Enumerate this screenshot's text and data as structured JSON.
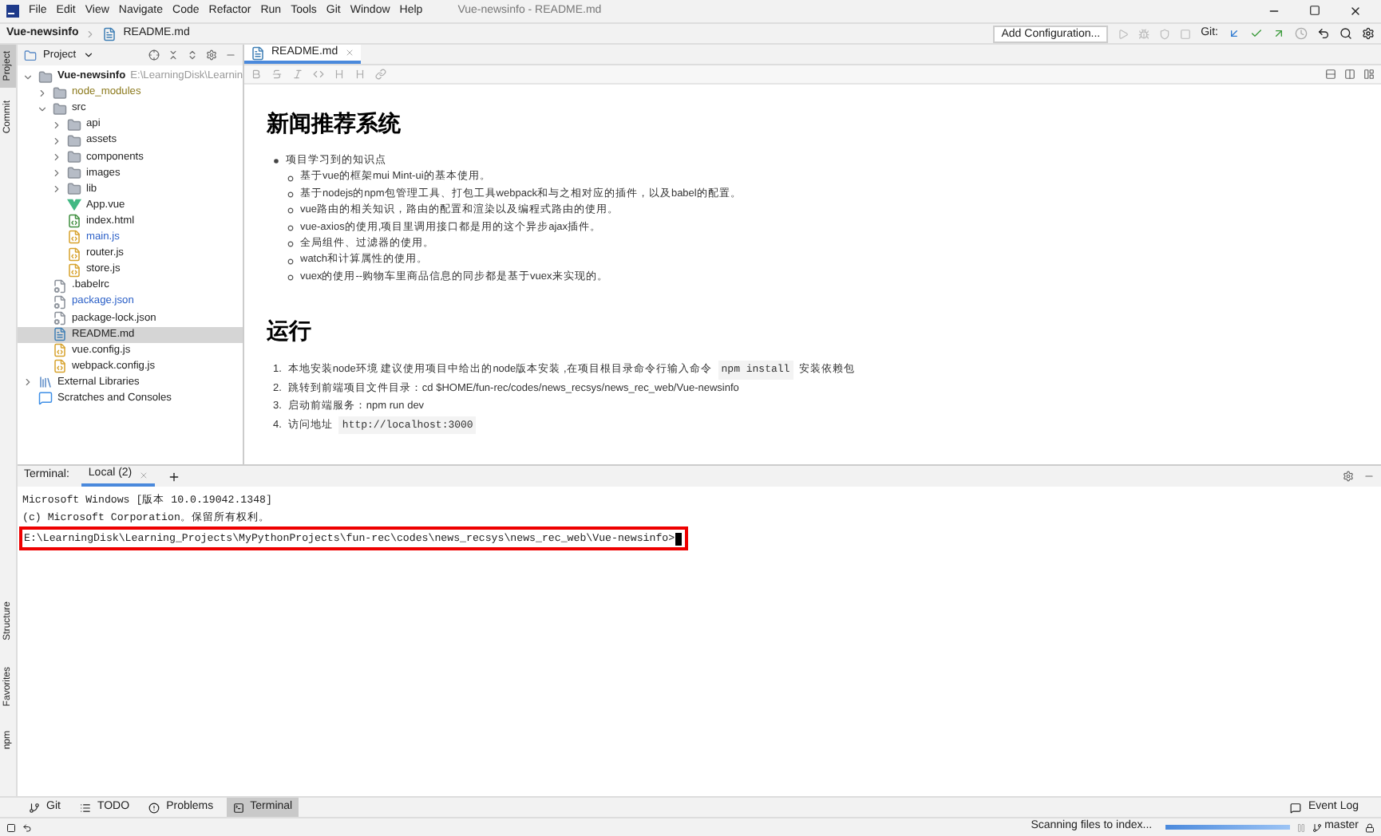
{
  "menu": [
    "File",
    "Edit",
    "View",
    "Navigate",
    "Code",
    "Refactor",
    "Run",
    "Tools",
    "Git",
    "Window",
    "Help"
  ],
  "window": {
    "title": "Vue-newsinfo - README.md"
  },
  "breadcrumb": [
    "Vue-newsinfo",
    "README.md"
  ],
  "toolbar": {
    "run_config": "Add Configuration...",
    "git_label": "Git:"
  },
  "left_strip_top": [
    {
      "label": "Project",
      "selected": true
    },
    {
      "label": "Commit",
      "selected": false
    }
  ],
  "left_strip_bottom": [
    {
      "label": "Structure",
      "selected": false
    },
    {
      "label": "Favorites",
      "selected": false
    },
    {
      "label": "npm",
      "selected": false
    }
  ],
  "project_panel": {
    "title": "Project",
    "tree": [
      {
        "label": "Vue-newsinfo",
        "path": "E:\\LearningDisk\\Learnin",
        "kind": "folder",
        "color": "#222222",
        "expanded": true,
        "selected": false,
        "children": [
          {
            "label": "node_modules",
            "kind": "folder",
            "color": "#8c7a1d",
            "expanded": false,
            "selected": false
          },
          {
            "label": "src",
            "kind": "folder",
            "color": "#222222",
            "expanded": true,
            "selected": false,
            "children": [
              {
                "label": "api",
                "kind": "folder",
                "color": "#222222",
                "expanded": false,
                "selected": false
              },
              {
                "label": "assets",
                "kind": "folder",
                "color": "#222222",
                "expanded": false,
                "selected": false
              },
              {
                "label": "components",
                "kind": "folder",
                "color": "#222222",
                "expanded": false,
                "selected": false
              },
              {
                "label": "images",
                "kind": "folder",
                "color": "#222222",
                "expanded": false,
                "selected": false
              },
              {
                "label": "lib",
                "kind": "folder",
                "color": "#222222",
                "expanded": false,
                "selected": false
              },
              {
                "label": "App.vue",
                "kind": "vue",
                "color": "#222222",
                "selected": false
              },
              {
                "label": "index.html",
                "kind": "html",
                "color": "#222222",
                "selected": false
              },
              {
                "label": "main.js",
                "kind": "js",
                "color": "#2a5fc7",
                "selected": false
              },
              {
                "label": "router.js",
                "kind": "js",
                "color": "#222222",
                "selected": false
              },
              {
                "label": "store.js",
                "kind": "js",
                "color": "#222222",
                "selected": false
              }
            ]
          },
          {
            "label": ".babelrc",
            "kind": "config",
            "color": "#222222",
            "selected": false
          },
          {
            "label": "package.json",
            "kind": "config",
            "color": "#2a5fc7",
            "selected": false
          },
          {
            "label": "package-lock.json",
            "kind": "config",
            "color": "#222222",
            "selected": false
          },
          {
            "label": "README.md",
            "kind": "markdown",
            "color": "#222222",
            "selected": true
          },
          {
            "label": "vue.config.js",
            "kind": "js",
            "color": "#222222",
            "selected": false
          },
          {
            "label": "webpack.config.js",
            "kind": "js",
            "color": "#222222",
            "selected": false
          }
        ]
      },
      {
        "label": "External Libraries",
        "kind": "library",
        "color": "#222222",
        "expanded": false,
        "selected": false
      },
      {
        "label": "Scratches and Consoles",
        "kind": "scratches",
        "color": "#222222",
        "selected": false
      }
    ]
  },
  "editor": {
    "tabs": [
      {
        "label": "README.md",
        "selected": true
      }
    ],
    "doc": [
      {
        "kind": "h1",
        "text": "新闻推荐系统"
      },
      {
        "kind": "ul",
        "text": "项目学习到的知识点",
        "children": [
          "基于vue的框架mui Mint-ui的基本使用。",
          "基于nodejs的npm包管理工具、打包工具webpack和与之相对应的插件，以及babel的配置。",
          "vue路由的相关知识，路由的配置和渲染以及编程式路由的使用。",
          "vue-axios的使用,项目里调用接口都是用的这个异步ajax插件。",
          "全局组件、过滤器的使用。",
          "watch和计算属性的使用。",
          "vuex的使用--购物车里商品信息的同步都是基于vuex来实现的。"
        ]
      },
      {
        "kind": "h1",
        "text": "运行"
      },
      {
        "kind": "ol",
        "items": [
          {
            "marker": "1.",
            "parts": [
              {
                "kind": "text",
                "text": "本地安装node环境 建议使用项目中给出的node版本安装 ,在项目根目录命令行输入命令"
              },
              {
                "kind": "code",
                "text": "npm install"
              },
              {
                "kind": "text",
                "text": "安装依赖包"
              }
            ]
          },
          {
            "marker": "2.",
            "parts": [
              {
                "kind": "text",
                "text": "跳转到前端项目文件目录：cd $HOME/fun-rec/codes/news_recsys/news_rec_web/Vue-newsinfo"
              }
            ]
          },
          {
            "marker": "3.",
            "parts": [
              {
                "kind": "text",
                "text": "启动前端服务：npm run dev"
              }
            ]
          },
          {
            "marker": "4.",
            "parts": [
              {
                "kind": "text",
                "text": "访问地址"
              },
              {
                "kind": "code",
                "text": "http://localhost:3000"
              }
            ]
          }
        ]
      }
    ]
  },
  "terminal": {
    "label": "Terminal:",
    "tabs": [
      {
        "label": "Local (2)",
        "selected": true
      }
    ],
    "lines": [
      {
        "text": "Microsoft Windows [版本 10.0.19042.1348]",
        "highlighted": false
      },
      {
        "text": "(c) Microsoft Corporation。保留所有权利。",
        "highlighted": false
      },
      {
        "text": "E:\\LearningDisk\\Learning_Projects\\MyPythonProjects\\fun-rec\\codes\\news_recsys\\news_rec_web\\Vue-newsinfo>",
        "highlighted": true
      }
    ]
  },
  "bottom_tabs": [
    {
      "label": "Git",
      "kind": "git",
      "selected": false
    },
    {
      "label": "TODO",
      "kind": "todo",
      "selected": false
    },
    {
      "label": "Problems",
      "kind": "problems",
      "selected": false
    },
    {
      "label": "Terminal",
      "kind": "terminal",
      "selected": true
    }
  ],
  "event_log": "Event Log",
  "status_bar": {
    "task": "Scanning files to index...",
    "level": 1,
    "branch": "master"
  }
}
